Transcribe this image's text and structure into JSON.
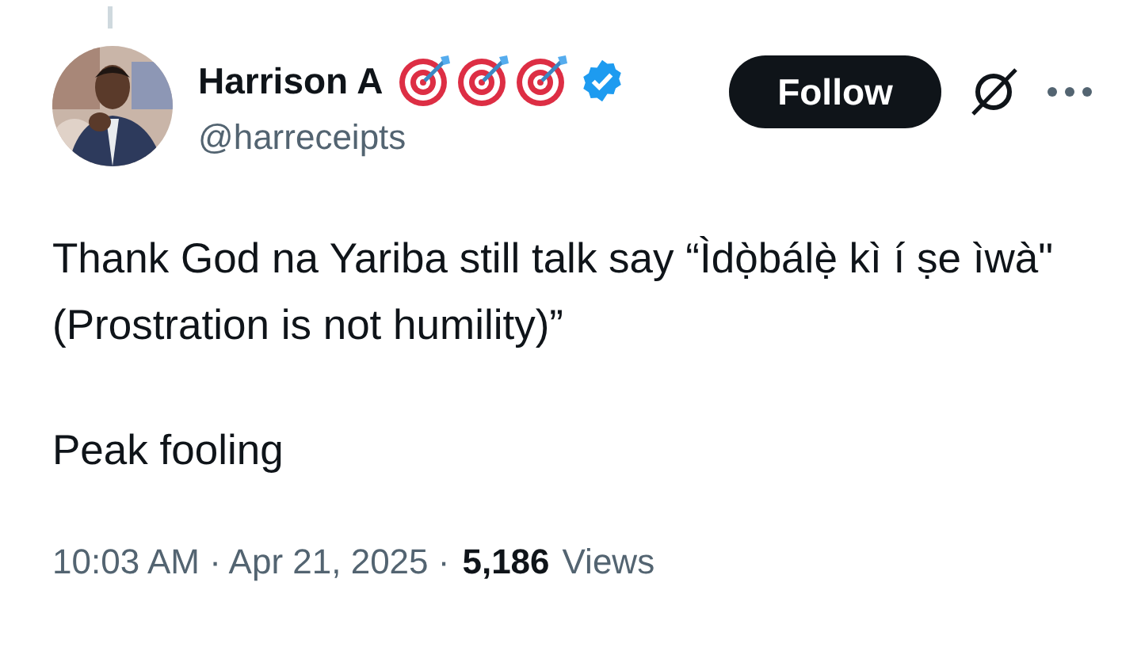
{
  "author": {
    "name": "Harrison A",
    "badges": [
      {
        "kind": "target"
      },
      {
        "kind": "target"
      },
      {
        "kind": "target"
      },
      {
        "kind": "verified"
      }
    ],
    "handle": "@harreceipts"
  },
  "follow_button": {
    "label": "Follow"
  },
  "post": {
    "paragraphs": [
      "Thank God na Yariba still talk say “Ìdọ̀bálẹ̀ kì í ṣe ìwà\" (Prostration is not humility)”",
      "Peak fooling"
    ]
  },
  "footer": {
    "timestamp": "10:03 AM · Apr 21, 2025 ·",
    "views_count": "5,186",
    "views_label": "Views"
  }
}
